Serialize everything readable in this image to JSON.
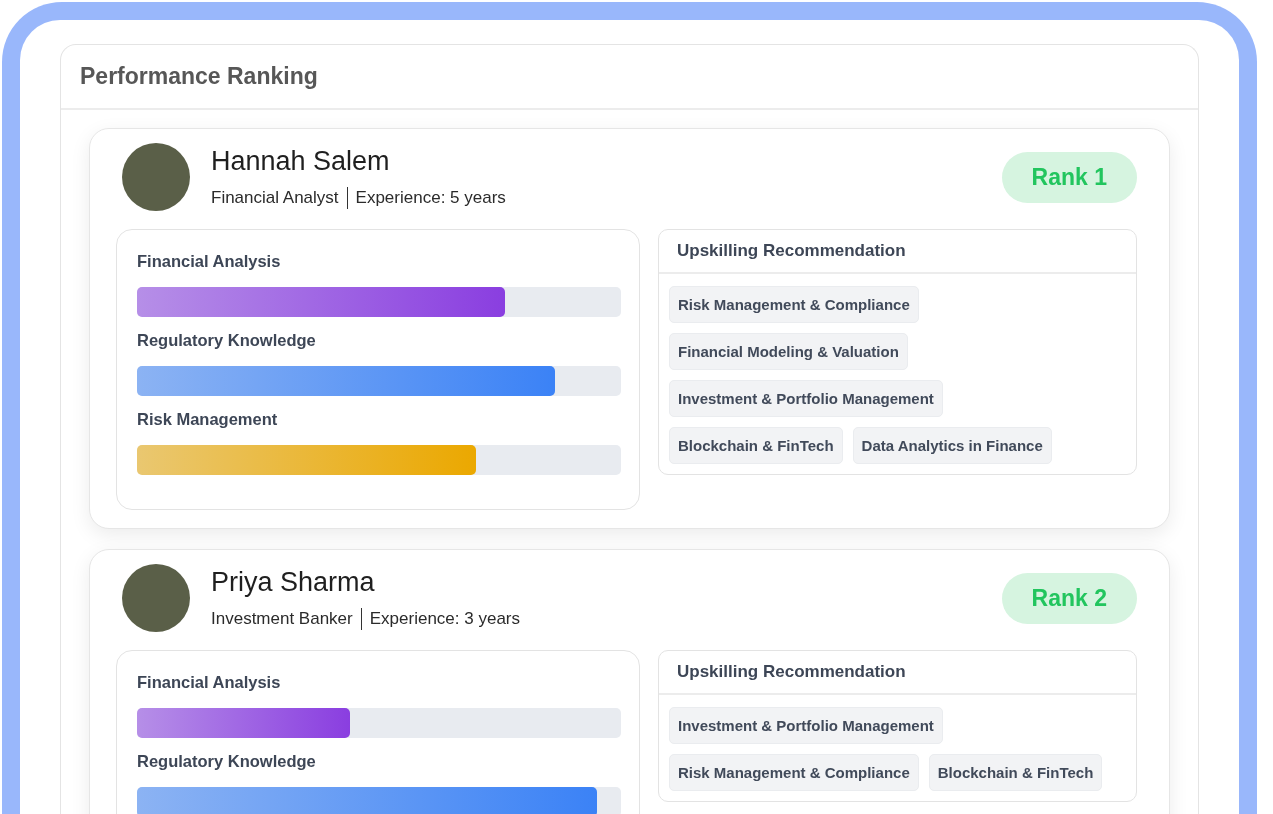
{
  "panel": {
    "title": "Performance Ranking"
  },
  "employees": [
    {
      "name": "Hannah Salem",
      "role": "Financial Analyst",
      "experience": "Experience: 5 years",
      "rank": "Rank 1",
      "skills": [
        {
          "label": "Financial Analysis",
          "level": 0.76,
          "color": "#8a3ee0"
        },
        {
          "label": "Regulatory Knowledge",
          "level": 0.864,
          "color": "#3b82f6"
        },
        {
          "label": "Risk Management",
          "level": 0.7,
          "color": "#eba800"
        }
      ],
      "recommendation_title": "Upskilling Recommendation",
      "recommendations": [
        "Risk Management & Compliance",
        "Financial Modeling & Valuation",
        "Investment & Portfolio Management",
        "Blockchain & FinTech",
        "Data Analytics in Finance"
      ]
    },
    {
      "name": "Priya Sharma",
      "role": "Investment Banker",
      "experience": "Experience: 3 years",
      "rank": "Rank 2",
      "skills": [
        {
          "label": "Financial Analysis",
          "level": 0.44,
          "color": "#8a3ee0"
        },
        {
          "label": "Regulatory Knowledge",
          "level": 0.95,
          "color": "#3b82f6"
        }
      ],
      "recommendation_title": "Upskilling Recommendation",
      "recommendations": [
        "Investment & Portfolio Management",
        "Risk Management & Compliance",
        "Blockchain & FinTech"
      ]
    }
  ]
}
